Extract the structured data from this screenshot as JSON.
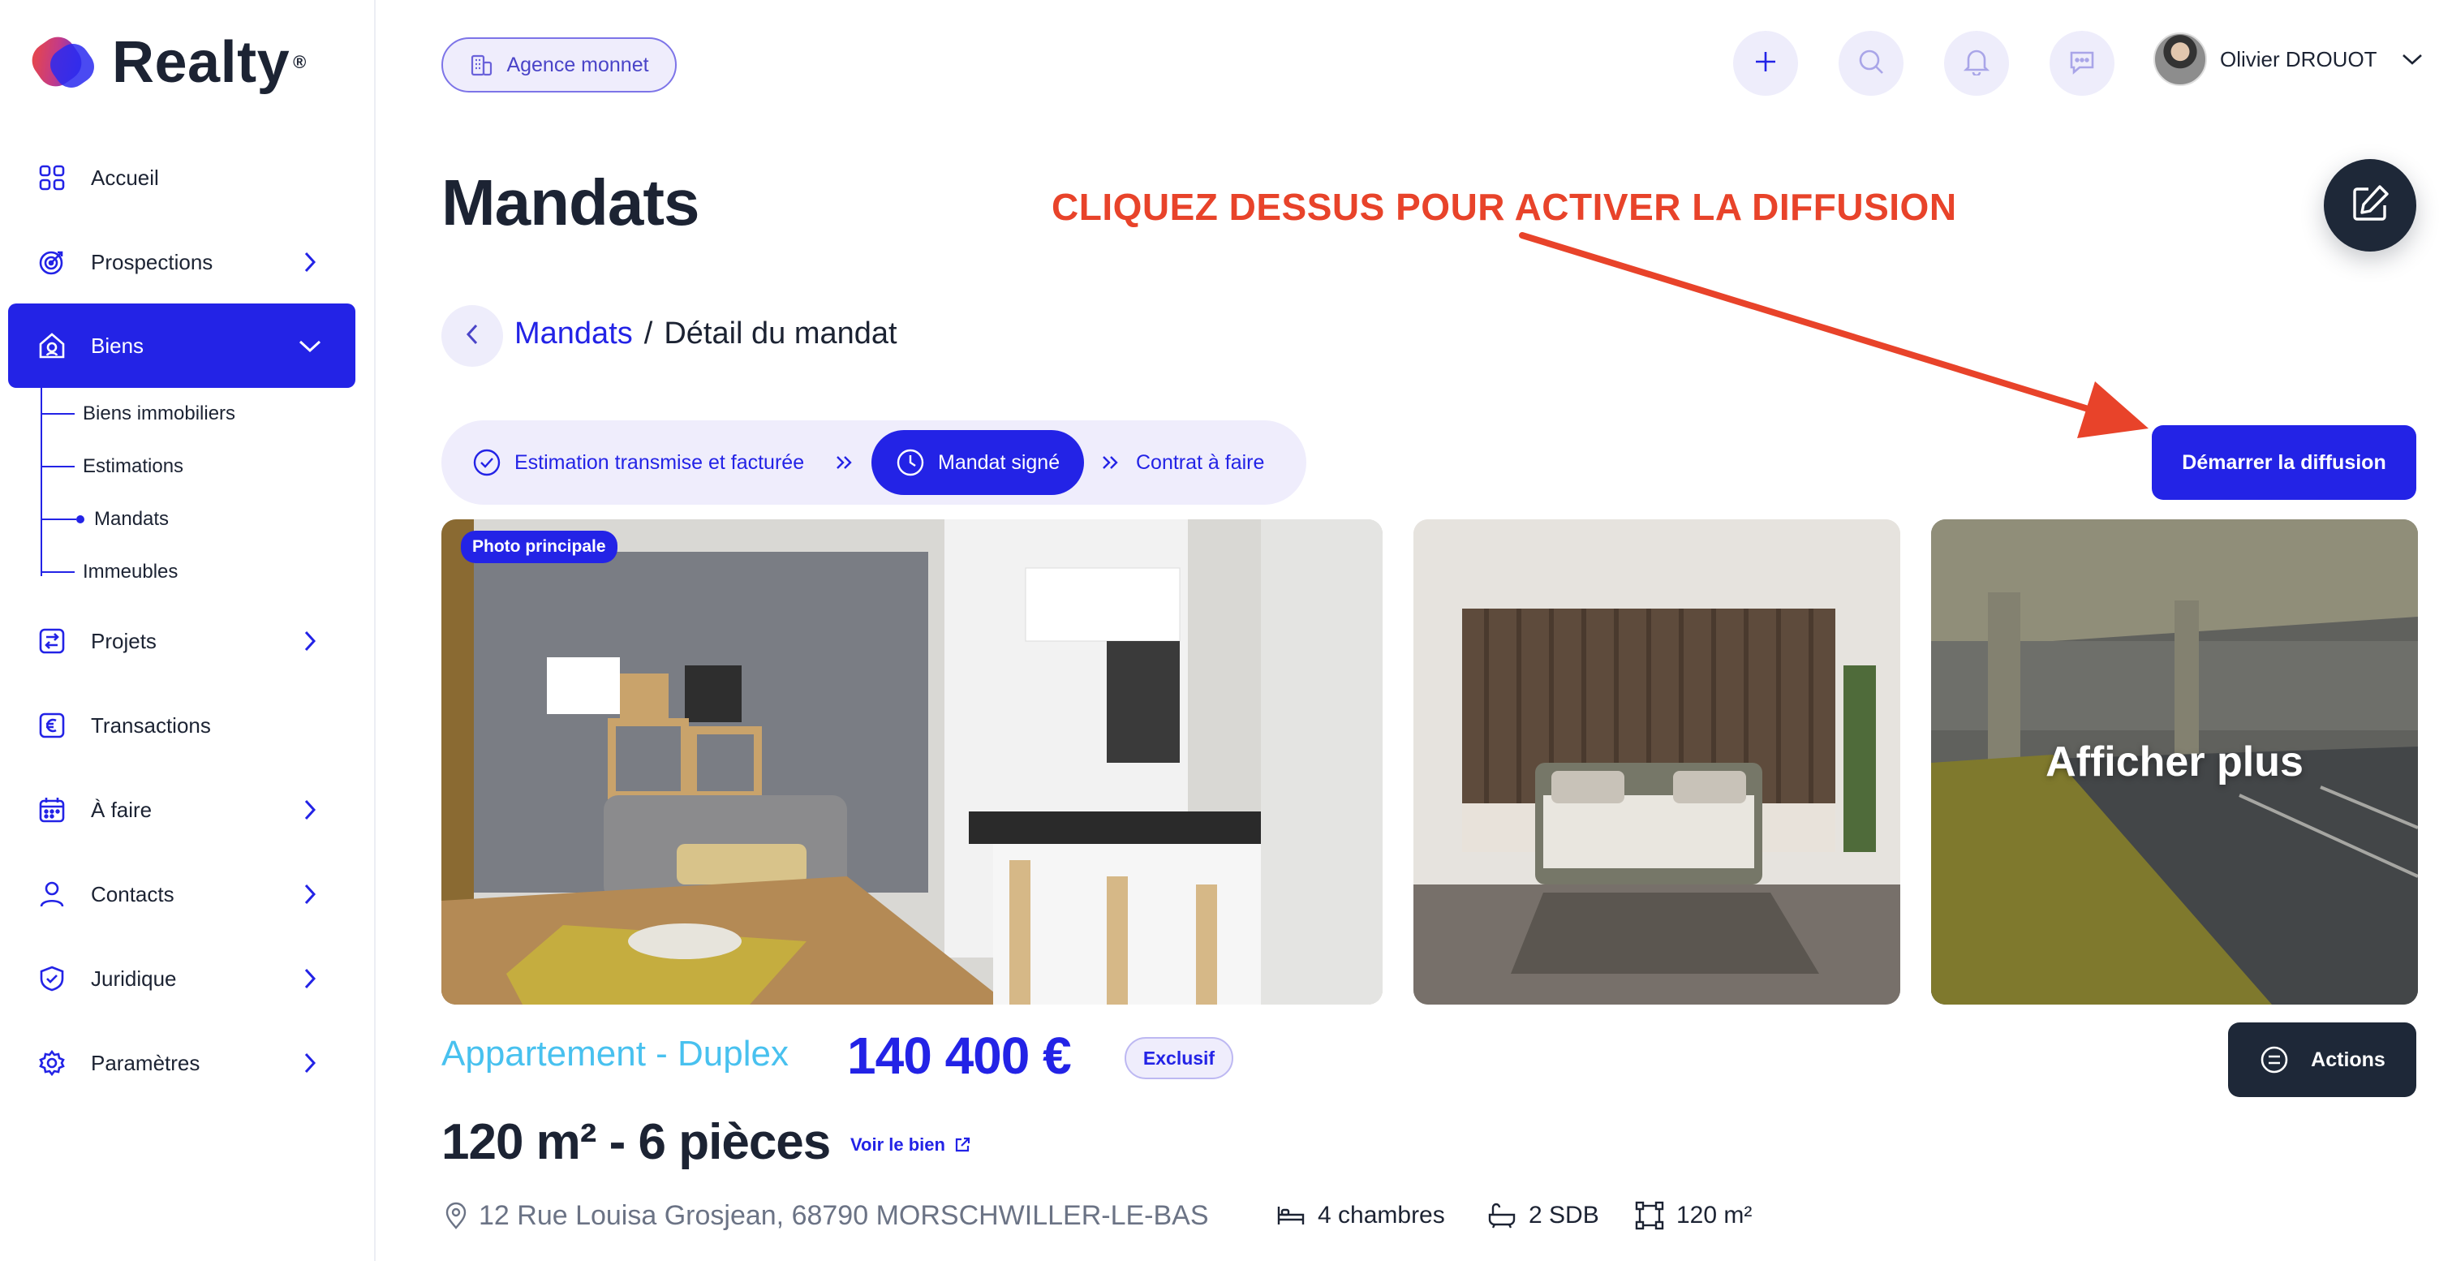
{
  "brand": {
    "name": "Realty",
    "reg": "®"
  },
  "sidebar": {
    "items": [
      {
        "label": "Accueil",
        "icon": "grid-icon"
      },
      {
        "label": "Prospections",
        "icon": "target-icon"
      },
      {
        "label": "Biens",
        "icon": "house-icon"
      },
      {
        "label": "Projets",
        "icon": "transfer-icon"
      },
      {
        "label": "Transactions",
        "icon": "euro-icon"
      },
      {
        "label": "À faire",
        "icon": "calendar-icon"
      },
      {
        "label": "Contacts",
        "icon": "user-icon"
      },
      {
        "label": "Juridique",
        "icon": "shield-icon"
      },
      {
        "label": "Paramètres",
        "icon": "gear-icon"
      }
    ],
    "biens_subitems": [
      {
        "label": "Biens immobiliers"
      },
      {
        "label": "Estimations"
      },
      {
        "label": "Mandats"
      },
      {
        "label": "Immeubles"
      }
    ]
  },
  "header": {
    "agency": "Agence monnet",
    "user_name": "Olivier DROUOT"
  },
  "page": {
    "title": "Mandats",
    "annotation": "CLIQUEZ DESSUS POUR ACTIVER LA DIFFUSION",
    "breadcrumb": {
      "parent": "Mandats",
      "separator": "/",
      "current": "Détail du mandat"
    }
  },
  "stepper": {
    "steps": [
      {
        "label": "Estimation transmise et facturée"
      },
      {
        "label": "Mandat signé"
      },
      {
        "label": "Contrat à faire"
      }
    ]
  },
  "cta": {
    "label": "Démarrer la diffusion"
  },
  "photos": {
    "main_badge": "Photo principale",
    "more_label": "Afficher plus"
  },
  "property": {
    "type": "Appartement - Duplex",
    "price": "140 400 €",
    "badge": "Exclusif",
    "size": "120 m² - 6 pièces",
    "see_link": "Voir le bien",
    "address": "12 Rue Louisa Grosjean, 68790 MORSCHWILLER-LE-BAS",
    "features": {
      "rooms": "4 chambres",
      "bathrooms": "2 SDB",
      "area": "120 m²"
    }
  },
  "actions": {
    "label": "Actions"
  },
  "colors": {
    "primary": "#2323e6",
    "dark": "#1e2838",
    "annotation": "#e8432a",
    "accent_type": "#48c1ef",
    "light_purple": "#efedfc"
  }
}
